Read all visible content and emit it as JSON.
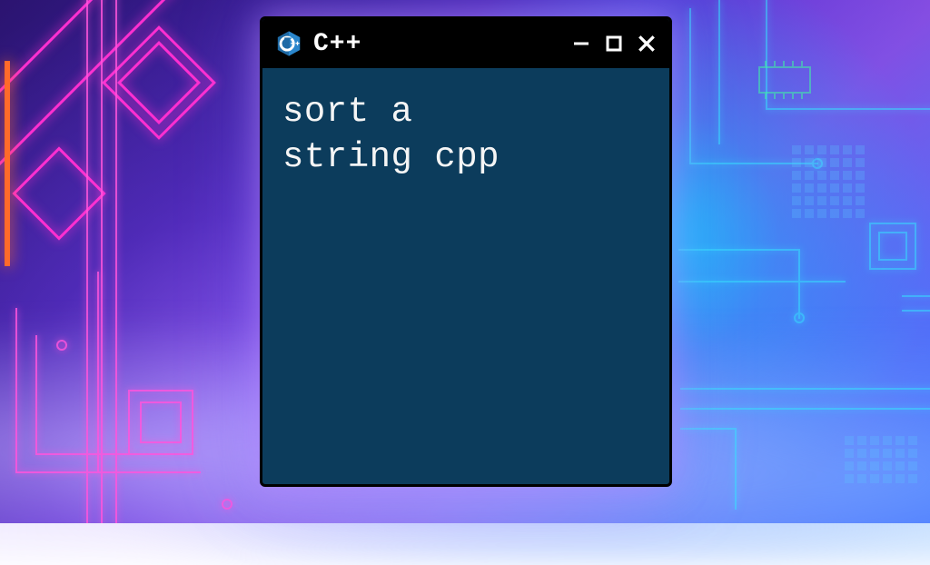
{
  "window": {
    "title": "C++",
    "content_text": "sort a\nstring cpp",
    "controls": {
      "minimize": "Minimize",
      "maximize": "Maximize",
      "close": "Close"
    }
  },
  "colors": {
    "window_bg": "#0c3c5c",
    "titlebar_bg": "#000000",
    "text": "#f5f5f5",
    "accent_magenta": "#ff2fd0",
    "accent_cyan": "#35e5ff",
    "accent_orange": "#ff6a2a"
  }
}
